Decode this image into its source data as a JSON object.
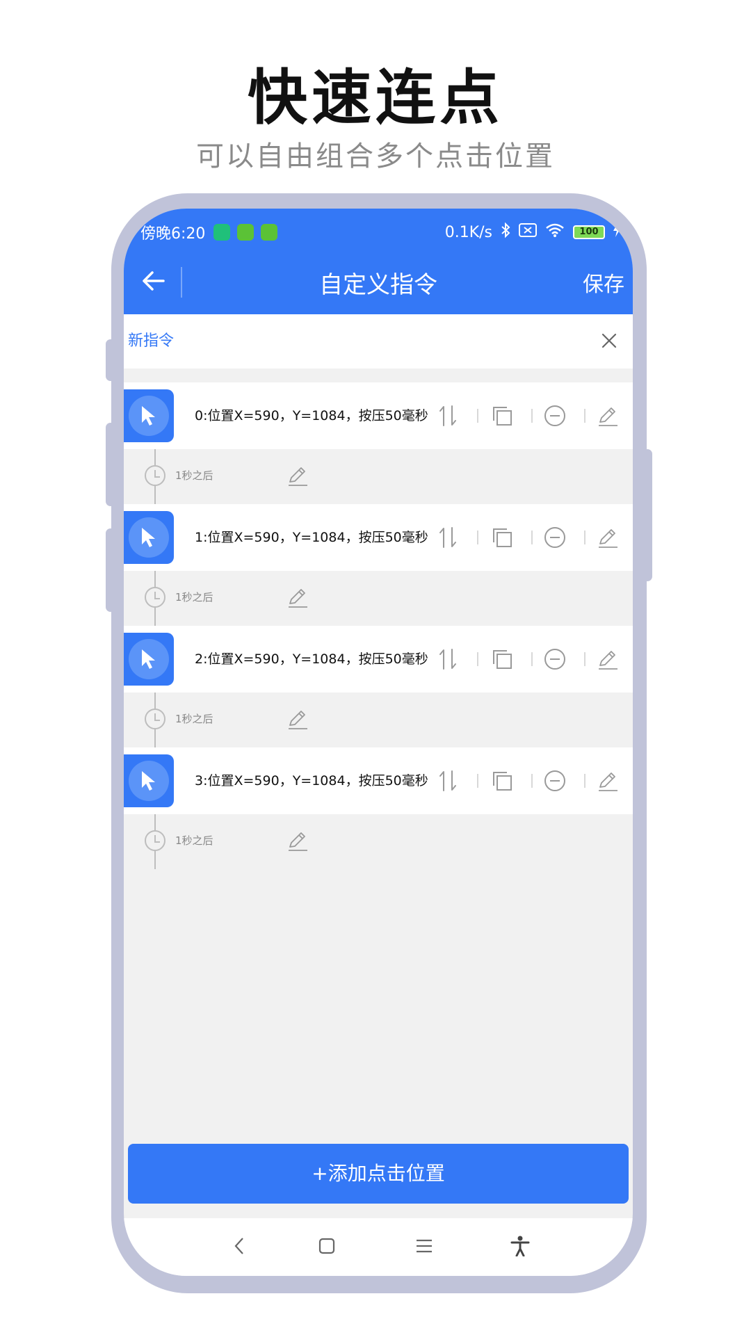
{
  "promo": {
    "title": "快速连点",
    "subtitle": "可以自由组合多个点击位置"
  },
  "status_bar": {
    "time": "傍晚6:20",
    "net_speed": "0.1K/s",
    "battery": "100"
  },
  "header": {
    "title": "自定义指令",
    "save_label": "保存"
  },
  "name_field": {
    "value": "新指令"
  },
  "commands": [
    {
      "text": "0:位置X=590，Y=1084，按压50毫秒",
      "delay": "1秒之后"
    },
    {
      "text": "1:位置X=590，Y=1084，按压50毫秒",
      "delay": "1秒之后"
    },
    {
      "text": "2:位置X=590，Y=1084，按压50毫秒",
      "delay": "1秒之后"
    },
    {
      "text": "3:位置X=590，Y=1084，按压50毫秒",
      "delay": "1秒之后"
    }
  ],
  "add_button": "+添加点击位置",
  "icons": {
    "back": "arrow-left-icon",
    "clear": "close-icon",
    "cursor": "cursor-icon",
    "reorder": "sort-icon",
    "copy": "copy-icon",
    "remove": "minus-circle-icon",
    "edit": "pencil-icon",
    "clock": "clock-icon"
  },
  "colors": {
    "primary": "#3478f6",
    "frame": "#c0c3d9",
    "background": "#f1f1f1"
  }
}
